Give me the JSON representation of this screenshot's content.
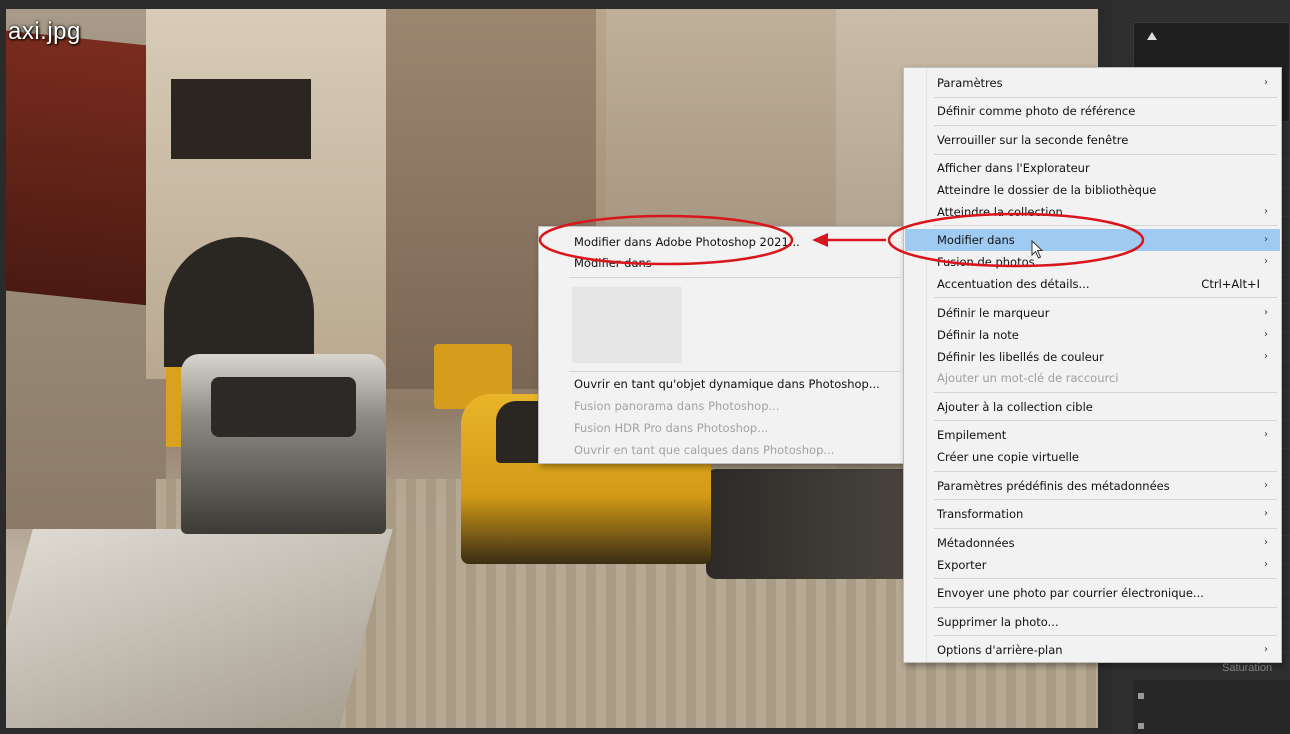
{
  "photo": {
    "filename": "axi.jpg"
  },
  "context_menu": {
    "items": [
      {
        "label": "Paramètres",
        "submenu": true
      },
      {
        "label": "Définir comme photo de référence"
      },
      {
        "label": "Verrouiller sur la seconde fenêtre"
      },
      {
        "label": "Afficher dans l'Explorateur"
      },
      {
        "label": "Atteindre le dossier de la bibliothèque"
      },
      {
        "label": "Atteindre la collection",
        "submenu": true
      },
      {
        "label": "Modifier dans",
        "submenu": true,
        "highlighted": true
      },
      {
        "label": "Fusion de photos",
        "submenu": true
      },
      {
        "label": "Accentuation des détails...",
        "shortcut": "Ctrl+Alt+I"
      },
      {
        "label": "Définir le marqueur",
        "submenu": true
      },
      {
        "label": "Définir la note",
        "submenu": true
      },
      {
        "label": "Définir les libellés de couleur",
        "submenu": true
      },
      {
        "label": "Ajouter un mot-clé de raccourci",
        "disabled": true
      },
      {
        "label": "Ajouter à la collection cible"
      },
      {
        "label": "Empilement",
        "submenu": true
      },
      {
        "label": "Créer une copie virtuelle"
      },
      {
        "label": "Paramètres prédéfinis des métadonnées",
        "submenu": true
      },
      {
        "label": "Transformation",
        "submenu": true
      },
      {
        "label": "Métadonnées",
        "submenu": true
      },
      {
        "label": "Exporter",
        "submenu": true
      },
      {
        "label": "Envoyer une photo par courrier électronique..."
      },
      {
        "label": "Supprimer la photo..."
      },
      {
        "label": "Options d'arrière-plan",
        "submenu": true
      }
    ],
    "arrow_glyph": "›"
  },
  "submenu": {
    "items": [
      {
        "label": "Modifier dans Adobe Photoshop 2021..."
      },
      {
        "label": "Modifier dans"
      },
      {
        "label": "Ouvrir en tant qu'objet dynamique dans Photoshop..."
      },
      {
        "label": "Fusion panorama dans Photoshop...",
        "disabled": true
      },
      {
        "label": "Fusion HDR Pro dans Photoshop...",
        "disabled": true
      },
      {
        "label": "Ouvrir en tant que calques dans Photoshop...",
        "disabled": true
      }
    ]
  },
  "right_panel": {
    "saturation_label": "Saturation"
  },
  "annotation_color": "#d8161b",
  "highlight_color": "#9fcbf2"
}
